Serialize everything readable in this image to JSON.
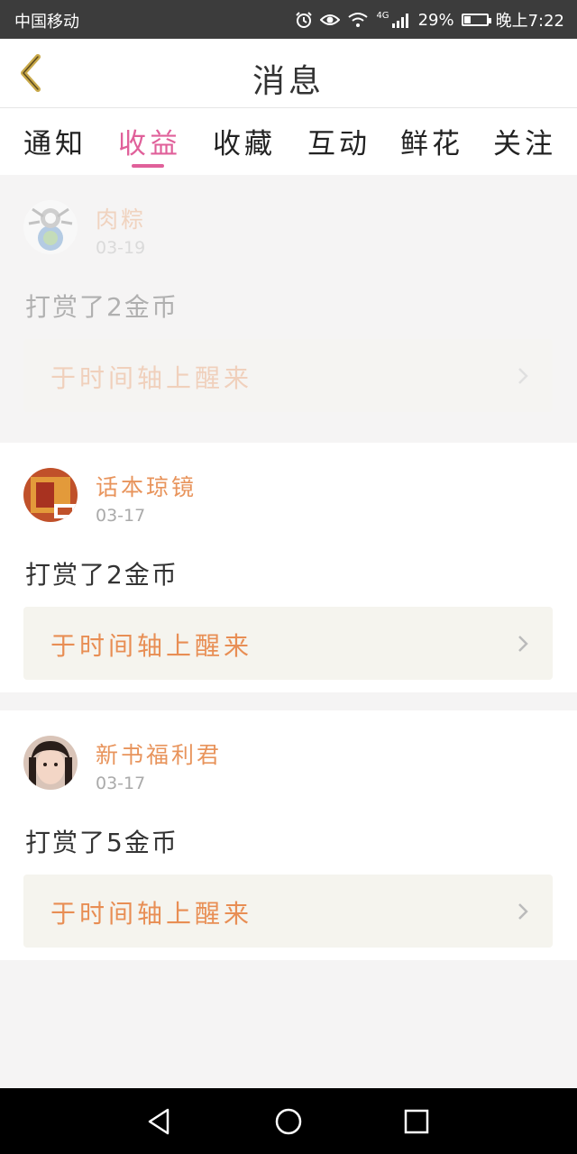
{
  "status_bar": {
    "carrier": "中国移动",
    "network": "4G",
    "battery": "29%",
    "battery_level": 0.29,
    "time": "晚上7:22"
  },
  "header": {
    "title": "消息",
    "back_icon": "chevron-left-icon"
  },
  "tabs": [
    {
      "label": "通知",
      "active": false
    },
    {
      "label": "收益",
      "active": true
    },
    {
      "label": "收藏",
      "active": false
    },
    {
      "label": "互动",
      "active": false
    },
    {
      "label": "鲜花",
      "active": false
    },
    {
      "label": "关注",
      "active": false
    }
  ],
  "messages": [
    {
      "username": "肉粽",
      "date": "03-19",
      "text": "打赏了2金币",
      "link": "于时间轴上醒来"
    },
    {
      "username": "话本琼镜",
      "date": "03-17",
      "text": "打赏了2金币",
      "link": "于时间轴上醒来"
    },
    {
      "username": "新书福利君",
      "date": "03-17",
      "text": "打赏了5金币",
      "link": "于时间轴上醒来"
    }
  ],
  "colors": {
    "accent": "#e0609a",
    "link": "#e88e54",
    "username": "#e8945c"
  },
  "nav_bar": {
    "back_icon": "triangle-back-icon",
    "home_icon": "circle-home-icon",
    "recents_icon": "square-recents-icon"
  }
}
